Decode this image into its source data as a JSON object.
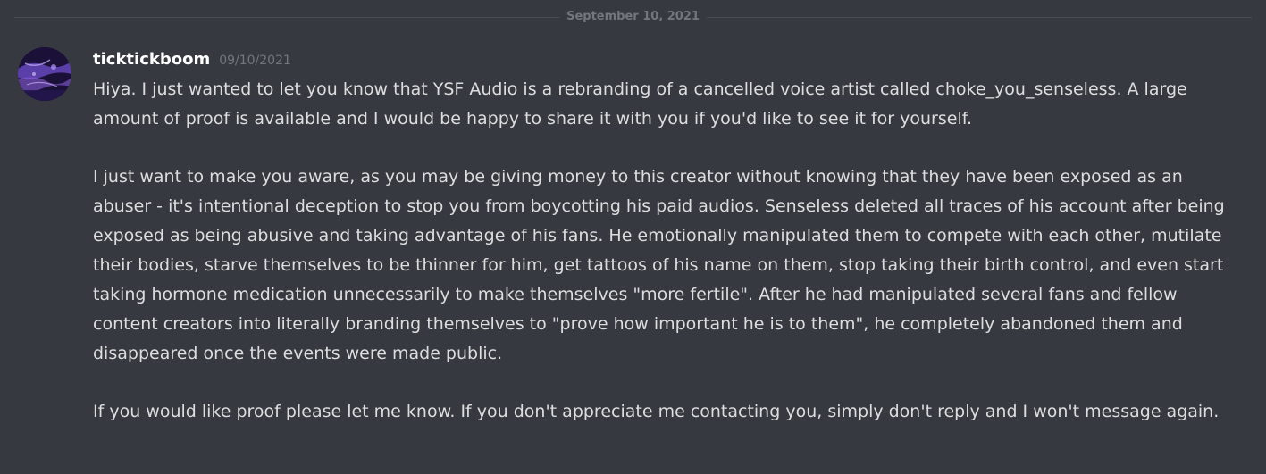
{
  "divider": {
    "date": "September 10, 2021"
  },
  "message": {
    "avatar_icon": "user-avatar",
    "username": "ticktickboom",
    "timestamp": "09/10/2021",
    "paragraphs": [
      "Hiya. I just wanted to let you know that YSF Audio is a rebranding of a cancelled voice artist called choke_you_senseless. A large amount of proof is available and I would be happy to share it with you if you'd like to see it for yourself.",
      "I just want to make you aware, as you may be giving money to this creator without knowing that they have been exposed as an abuser - it's intentional deception to stop you from boycotting his paid audios. Senseless deleted all traces of his account after being exposed as being abusive and taking advantage of his fans. He emotionally manipulated them to compete with each other, mutilate their bodies, starve themselves to be thinner for him, get tattoos of his name on them, stop taking their birth control, and even start taking hormone medication unnecessarily to make themselves \"more fertile\". After he had manipulated several fans and fellow content creators into literally branding themselves to \"prove how important he is to them\", he completely abandoned them and disappeared once the events were made public.",
      "If you would like proof please let me know. If you don't appreciate me contacting you, simply don't reply and I won't message again."
    ]
  },
  "colors": {
    "background": "#36393f",
    "username": "#ffffff",
    "text": "#dcddde",
    "muted": "#72767d",
    "divider_line": "#4a4d53"
  }
}
